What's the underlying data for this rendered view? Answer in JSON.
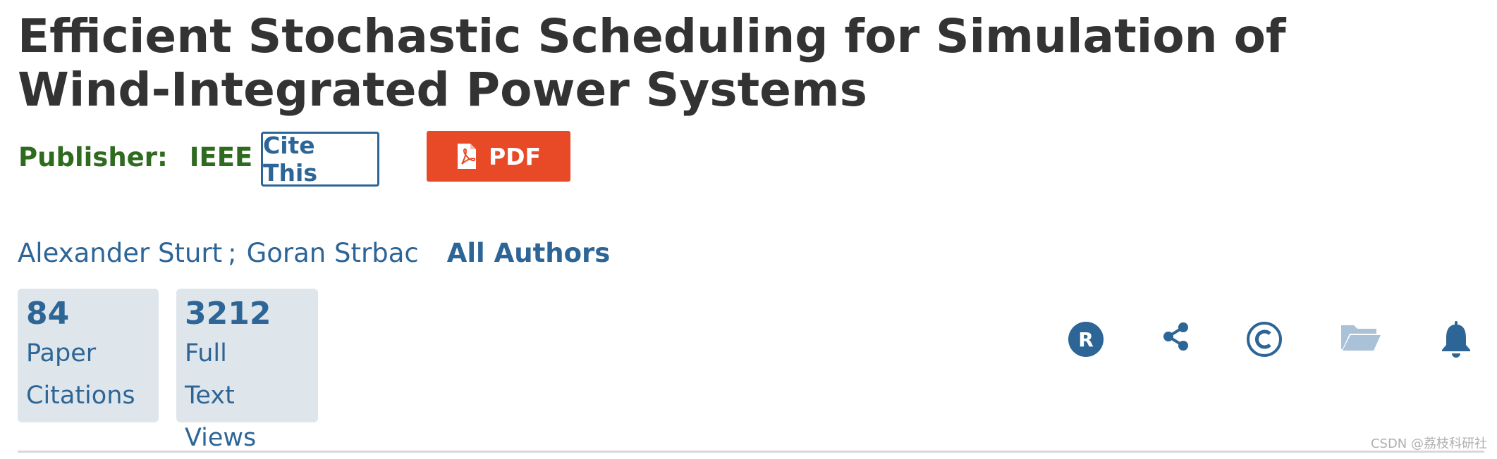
{
  "article": {
    "title": "Efficient Stochastic Scheduling for Simulation of Wind-Integrated Power Systems",
    "publisher_label": "Publisher:",
    "publisher_name": "IEEE"
  },
  "actions": {
    "cite_label": "Cite This",
    "pdf_label": "PDF"
  },
  "authors": {
    "items": [
      "Alexander Sturt",
      "Goran Strbac"
    ],
    "separator": ";",
    "all_label": "All Authors"
  },
  "metrics": [
    {
      "value": "84",
      "label": "Paper Citations"
    },
    {
      "value": "3212",
      "label": "Full Text Views"
    }
  ],
  "toolbar_icons": [
    "rights-icon",
    "share-icon",
    "copyright-icon",
    "folder-icon",
    "bell-icon"
  ],
  "colors": {
    "title": "#333333",
    "publisher": "#2f6b1f",
    "link": "#2d6597",
    "pdf_button": "#e84a27",
    "metric_bg": "#dfe6eb",
    "folder_icon": "#a9c2d8"
  },
  "watermark": "CSDN @荔枝科研社"
}
